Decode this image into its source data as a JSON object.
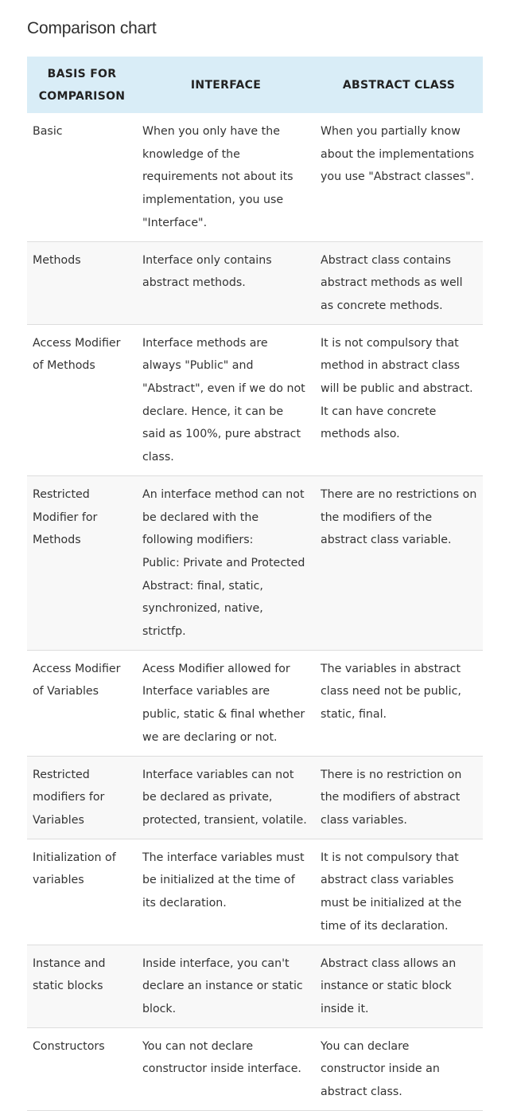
{
  "title": "Comparison chart",
  "columns": [
    "BASIS FOR COMPARISON",
    "INTERFACE",
    "ABSTRACT CLASS"
  ],
  "rows": [
    {
      "basis": "Basic",
      "interface": [
        "When you only have the knowledge of the requirements not about its implementation, you use \"Interface\"."
      ],
      "abstract_class": [
        "When you partially know about the implementations you use \"Abstract classes\"."
      ]
    },
    {
      "basis": "Methods",
      "interface": [
        "Interface only contains abstract methods."
      ],
      "abstract_class": [
        "Abstract class contains abstract methods as well as concrete methods."
      ]
    },
    {
      "basis": "Access Modifier of Methods",
      "interface": [
        "Interface methods are always \"Public\" and \"Abstract\", even if we do not declare. Hence, it can be said as 100%, pure abstract class."
      ],
      "abstract_class": [
        "It is not compulsory that method in abstract class will be public and abstract. It can have concrete methods also."
      ]
    },
    {
      "basis": "Restricted Modifier for Methods",
      "interface": [
        "An interface method can not be declared with the following modifiers:",
        "Public: Private and Protected",
        "Abstract: final, static, synchronized, native, strictfp."
      ],
      "abstract_class": [
        "There are no restrictions on the modifiers of the abstract class variable."
      ]
    },
    {
      "basis": "Access Modifier of Variables",
      "interface": [
        "Acess Modifier allowed for Interface variables are public, static & final whether we are declaring or not."
      ],
      "abstract_class": [
        "The variables in abstract class need not be public, static, final."
      ]
    },
    {
      "basis": "Restricted modifiers for Variables",
      "interface": [
        "Interface variables can not be declared as private, protected, transient, volatile."
      ],
      "abstract_class": [
        "There is no restriction on the modifiers of abstract class variables."
      ]
    },
    {
      "basis": "Initialization of variables",
      "interface": [
        "The interface variables must be initialized at the time of its declaration."
      ],
      "abstract_class": [
        "It is not compulsory that abstract class variables must be initialized at the time of its declaration."
      ]
    },
    {
      "basis": "Instance and static blocks",
      "interface": [
        "Inside interface, you can't declare an instance or static block."
      ],
      "abstract_class": [
        "Abstract class allows an instance or static block inside it."
      ]
    },
    {
      "basis": "Constructors",
      "interface": [
        "You can not declare constructor inside interface."
      ],
      "abstract_class": [
        "You can declare constructor inside an abstract class."
      ]
    }
  ],
  "colors": {
    "header_background": "#d9edf7",
    "stripe_background": "#f8f8f8",
    "row_divider": "#dddddd"
  }
}
